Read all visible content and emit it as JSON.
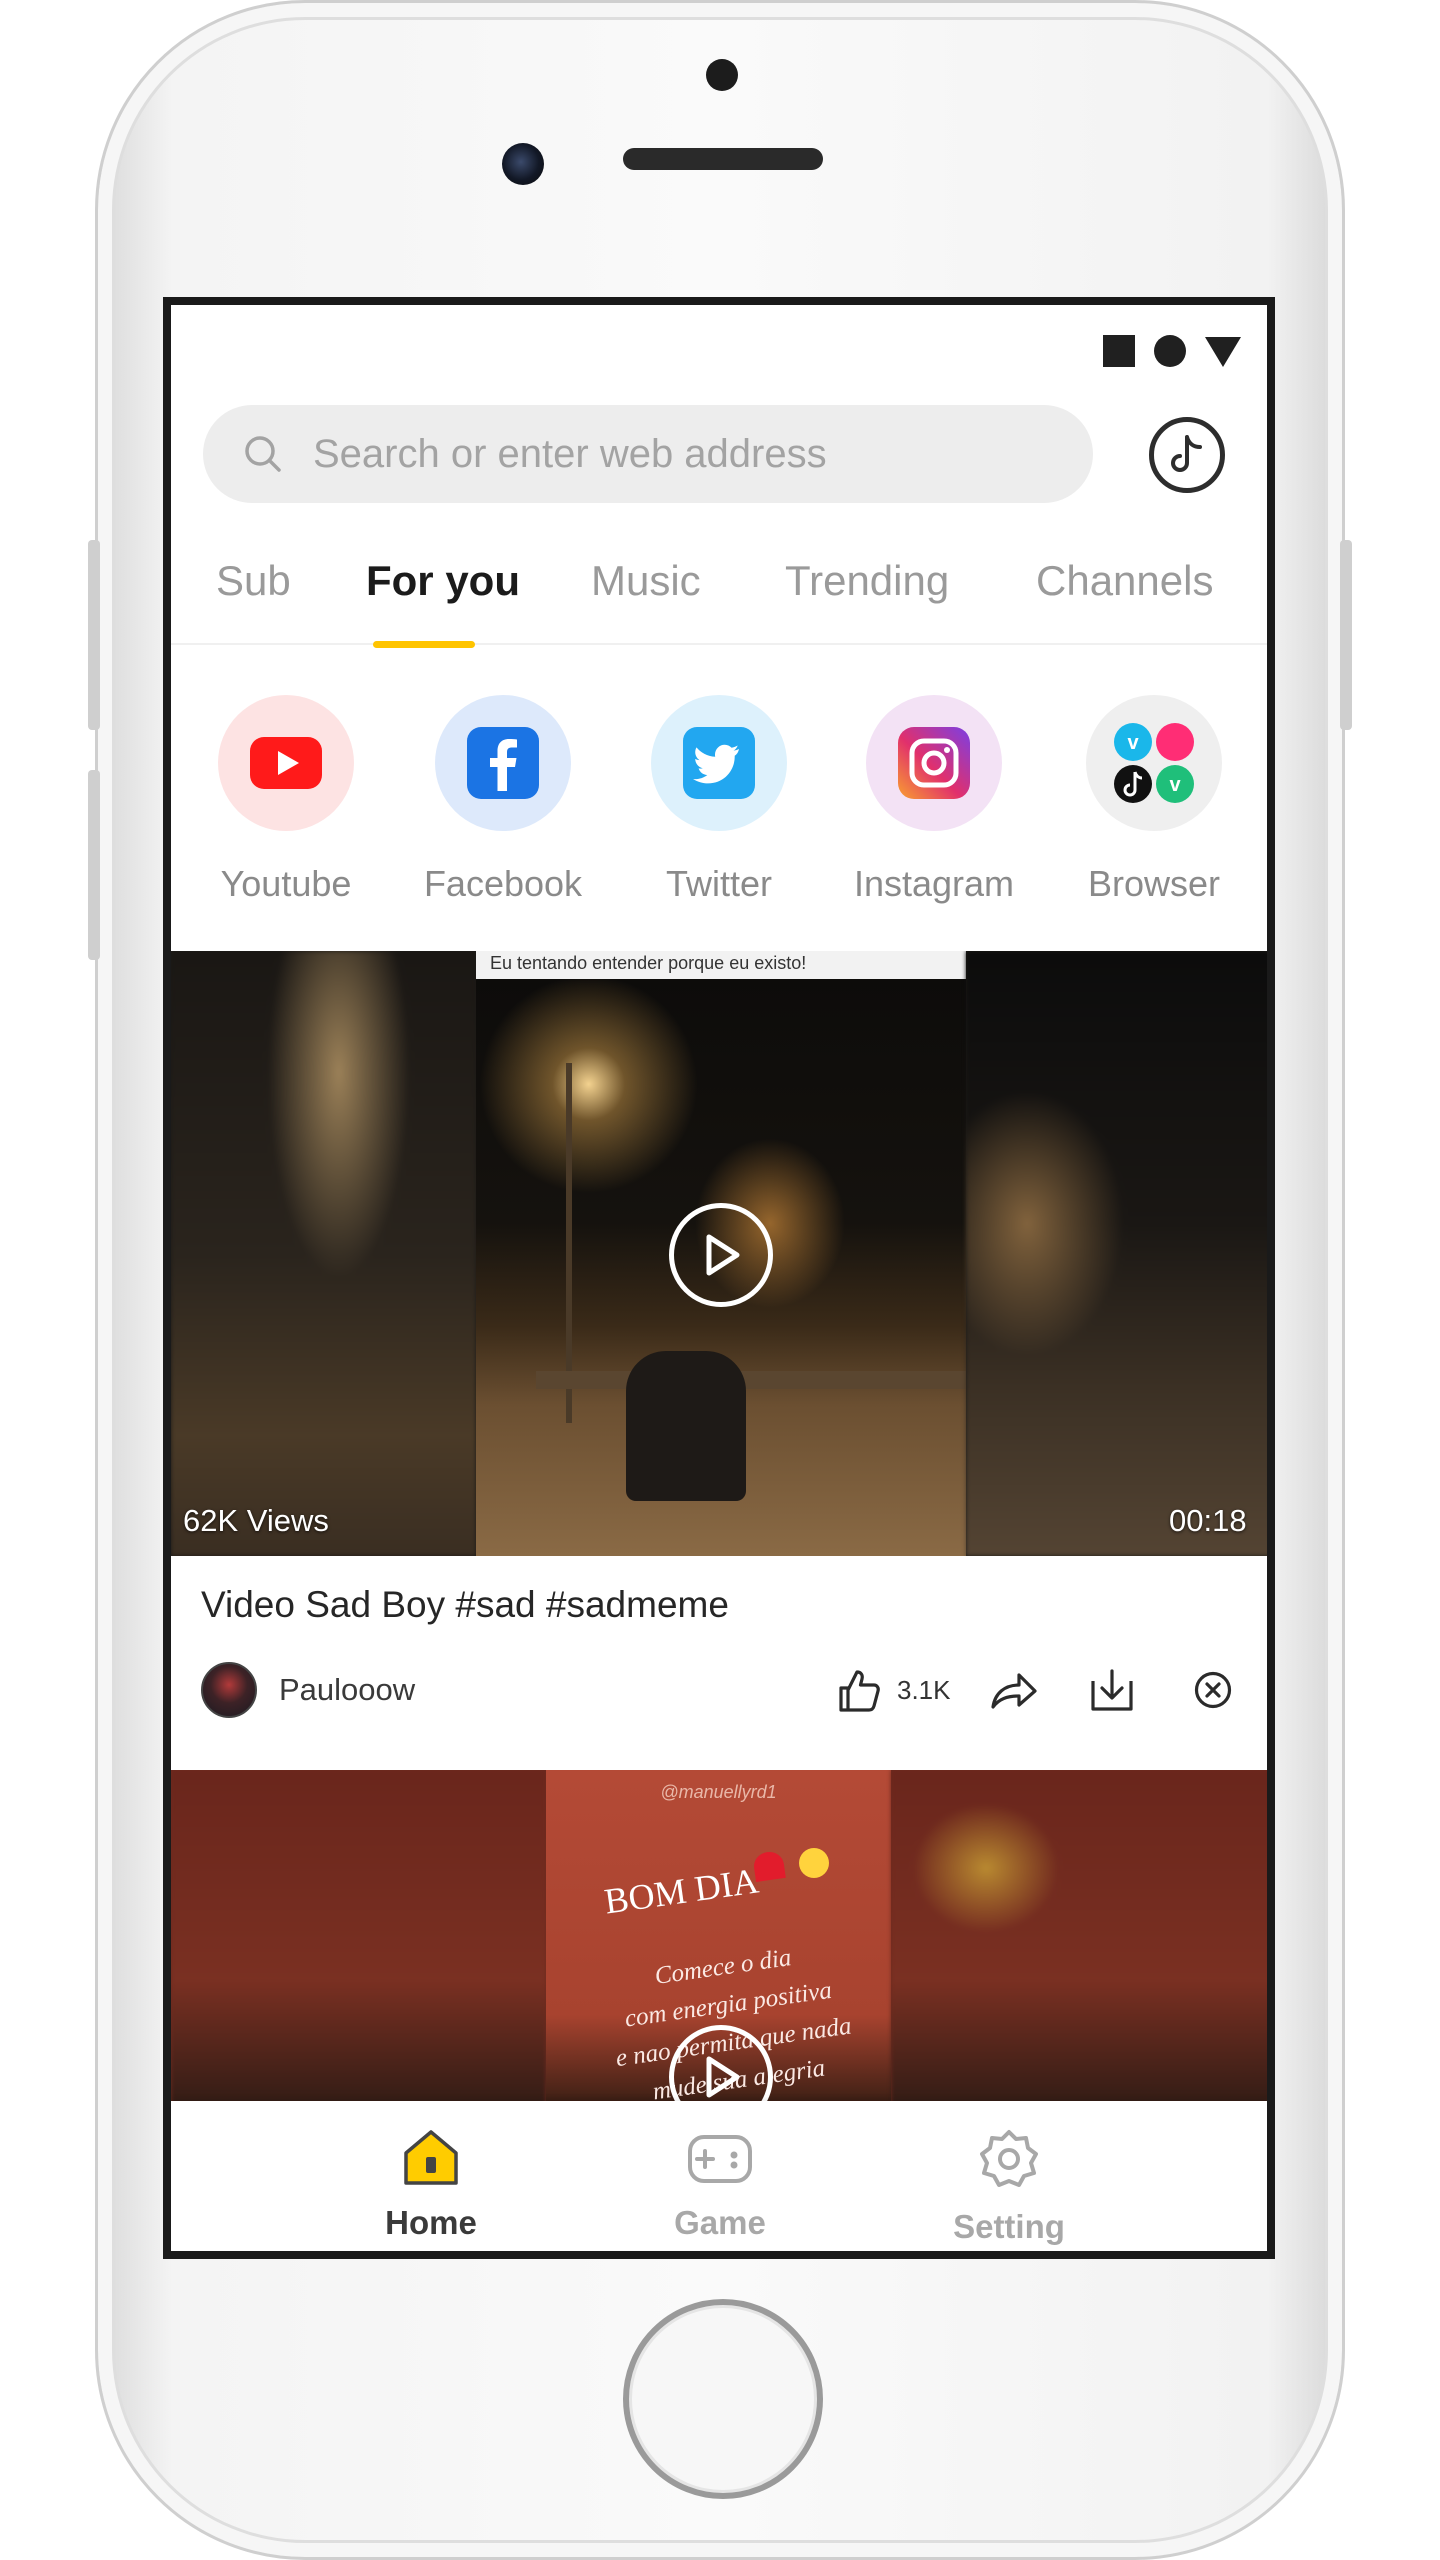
{
  "search": {
    "placeholder": "Search or enter web address"
  },
  "tabs": [
    {
      "label": "Sub",
      "active": false
    },
    {
      "label": "For you",
      "active": true
    },
    {
      "label": "Music",
      "active": false
    },
    {
      "label": "Trending",
      "active": false
    },
    {
      "label": "Channels",
      "active": false
    }
  ],
  "shortcuts": [
    {
      "label": "Youtube",
      "icon": "youtube-icon",
      "color": "#ff0000"
    },
    {
      "label": "Facebook",
      "icon": "facebook-icon",
      "color": "#1877f2"
    },
    {
      "label": "Twitter",
      "icon": "twitter-icon",
      "color": "#1da1f2"
    },
    {
      "label": "Instagram",
      "icon": "instagram-icon",
      "color": "#c13584"
    },
    {
      "label": "Browser",
      "icon": "browser-apps-icon",
      "color": "#ff2d75"
    }
  ],
  "feed": [
    {
      "caption": "Eu tentando entender porque eu existo!",
      "views": "62K Views",
      "duration": "00:18",
      "title": "Video Sad Boy  #sad #sadmeme",
      "author": "Paulooow",
      "likes": "3.1K"
    },
    {
      "watermark": "@manuellyrd1",
      "headline": "BOM DIA",
      "text": "Comece o dia\ncom energia positiva\ne nao permita que nada\nmude sua alegria"
    }
  ],
  "bottom_nav": [
    {
      "label": "Home",
      "icon": "home-icon",
      "active": true
    },
    {
      "label": "Game",
      "icon": "gamepad-icon",
      "active": false
    },
    {
      "label": "Setting",
      "icon": "gear-icon",
      "active": false
    }
  ],
  "colors": {
    "accent": "#ffc400",
    "text_primary": "#1b1b1b",
    "text_muted": "#9a9a9a"
  }
}
